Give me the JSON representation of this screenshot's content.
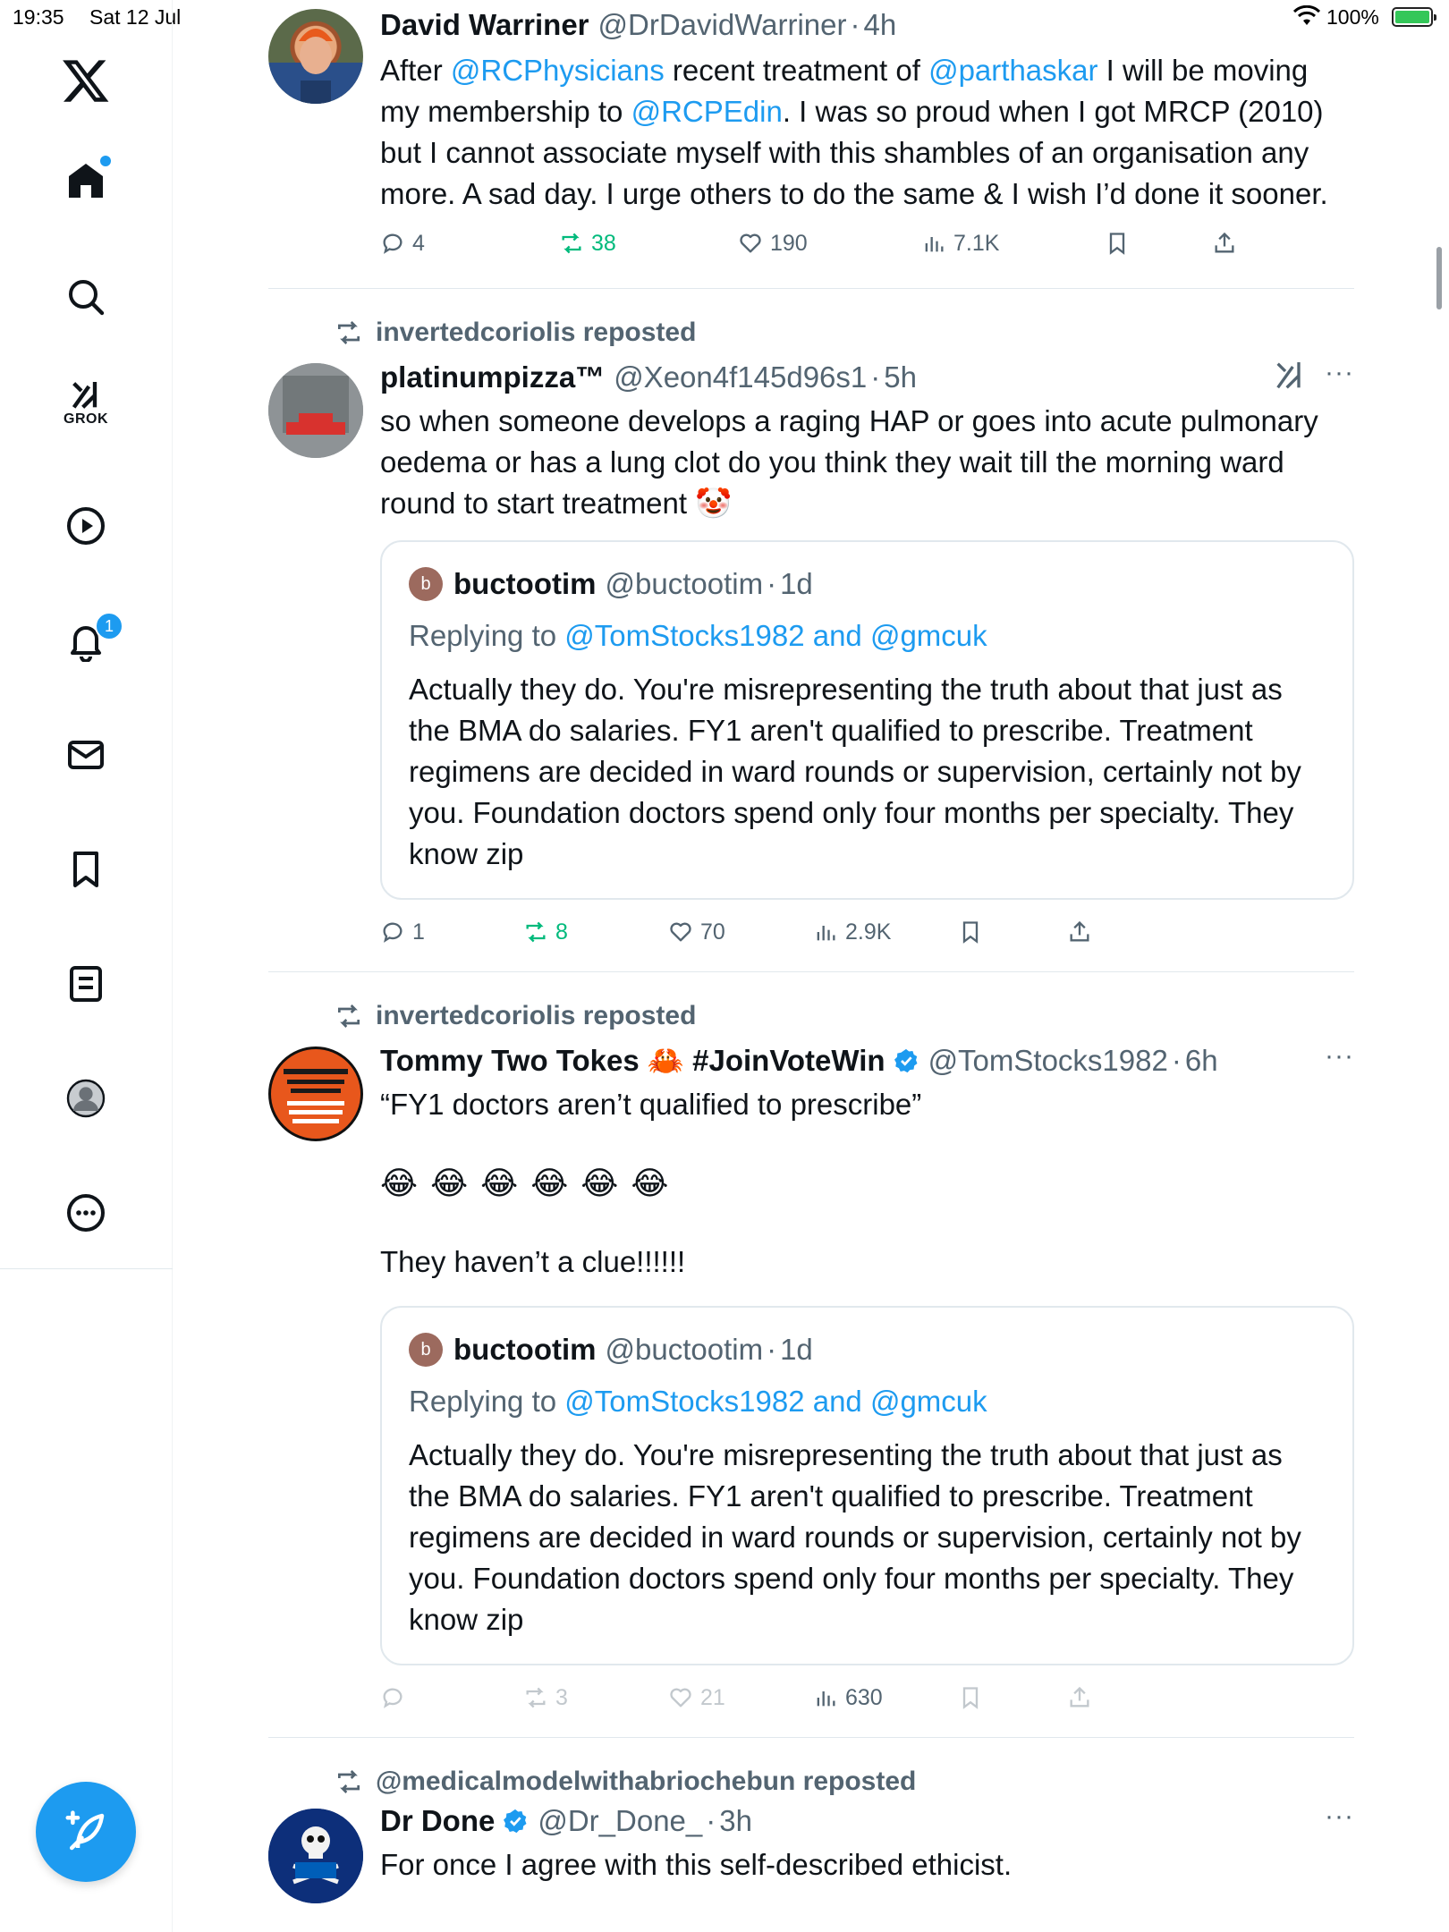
{
  "status_bar": {
    "time": "19:35",
    "date": "Sat 12 Jul",
    "battery": "100%"
  },
  "sidebar": {
    "notification_badge": "1",
    "grok_label": "GROK",
    "icons": [
      "x-logo-icon",
      "home-icon",
      "search-icon",
      "grok-icon",
      "video-icon",
      "bell-icon",
      "mail-icon",
      "bookmark-icon",
      "list-icon",
      "profile-icon",
      "more-icon",
      "compose-icon"
    ]
  },
  "tweets": [
    {
      "display_name": "David Warriner",
      "handle": "@DrDavidWarriner",
      "time": "4h",
      "text_parts": [
        "After ",
        "@RCPhysicians",
        " recent treatment of ",
        "@parthaskar",
        " I will be moving my membership to ",
        "@RCPEdin",
        ". I was so proud when I got MRCP (2010) but I cannot associate myself with this shambles of an organisation any more. A sad day. I urge others to do the same & I wish I’d done it sooner."
      ],
      "replies": "4",
      "reposts": "38",
      "likes": "190",
      "views": "7.1K"
    },
    {
      "repost_by": "invertedcoriolis reposted",
      "display_name": "platinumpizza™",
      "handle": "@Xeon4f145d96s1",
      "time": "5h",
      "text": "so when someone develops a raging HAP or goes into acute pulmonary oedema or has a lung clot do you think they wait till the morning ward round to start treatment 🤡",
      "quote": {
        "avatar_letter": "b",
        "display_name": "buctootim",
        "handle": "@buctootim",
        "time": "1d",
        "replying_label": "Replying to ",
        "replying_to": "@TomStocks1982 and @gmcuk",
        "text": "Actually they do. You're misrepresenting the truth about that just as the BMA do salaries. FY1 aren't qualified to prescribe. Treatment regimens are decided in ward rounds or supervision, certainly not by you. Foundation doctors spend only four months per specialty. They know zip"
      },
      "replies": "1",
      "reposts": "8",
      "likes": "70",
      "views": "2.9K"
    },
    {
      "repost_by": "invertedcoriolis reposted",
      "display_name": "Tommy Two Tokes 🦀 #JoinVoteWin",
      "handle": "@TomStocks1982",
      "time": "6h",
      "text_line1": "“FY1 doctors aren’t qualified to prescribe”",
      "emoji_line": "😂😂😂😂😂😂",
      "text_line2": "They haven’t a clue!!!!!!",
      "quote": {
        "avatar_letter": "b",
        "display_name": "buctootim",
        "handle": "@buctootim",
        "time": "1d",
        "replying_label": "Replying to ",
        "replying_to": "@TomStocks1982 and @gmcuk",
        "text": "Actually they do. You're misrepresenting the truth about that just as the BMA do salaries. FY1 aren't qualified to prescribe. Treatment regimens are decided in ward rounds or supervision, certainly not by you. Foundation doctors spend only four months per specialty. They know zip"
      },
      "replies": "",
      "reposts": "3",
      "likes": "21",
      "views": "630"
    },
    {
      "repost_by": "@medicalmodelwithabriochebun reposted",
      "display_name": "Dr Done",
      "handle": "@Dr_Done_",
      "time": "3h",
      "text": "For once I agree with this self-described ethicist."
    }
  ],
  "colors": {
    "accent": "#1d9bf0",
    "repost_green": "#00ba7c",
    "muted": "#536471",
    "verified": "#1d9bf0"
  }
}
